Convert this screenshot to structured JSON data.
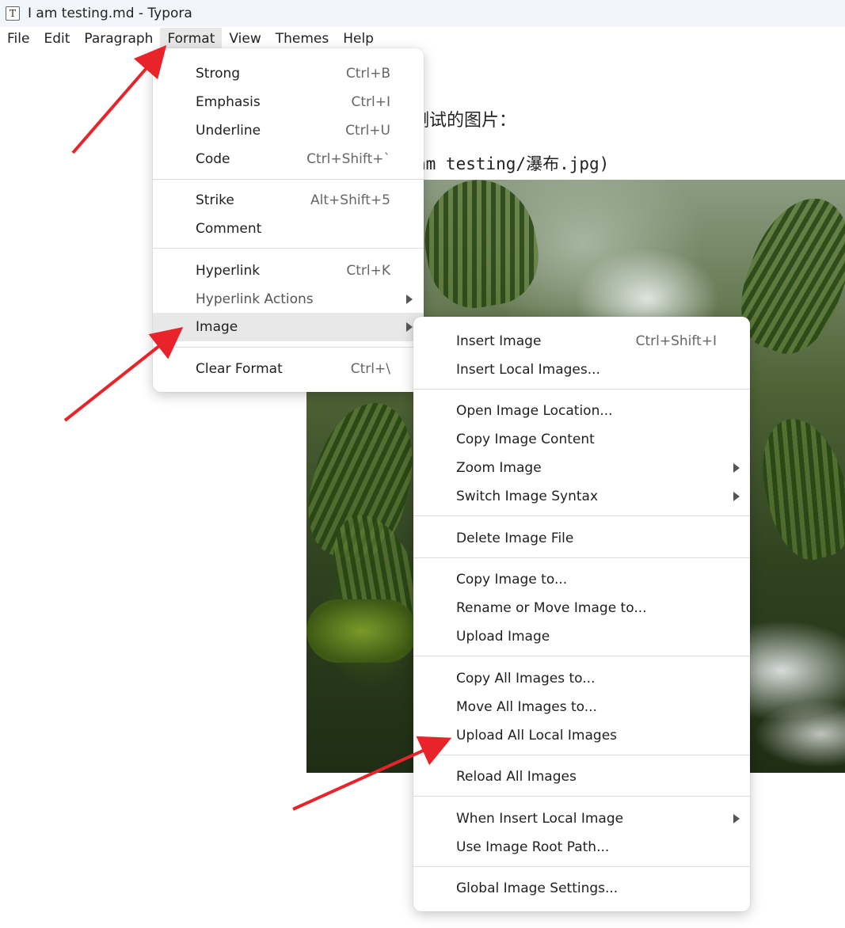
{
  "window": {
    "title": "I am testing.md - Typora",
    "app_icon_letter": "T"
  },
  "menubar": [
    {
      "label": "File"
    },
    {
      "label": "Edit"
    },
    {
      "label": "Paragraph"
    },
    {
      "label": "Format",
      "active": true
    },
    {
      "label": "View"
    },
    {
      "label": "Themes"
    },
    {
      "label": "Help"
    }
  ],
  "document": {
    "line1_visible": "测试的图片：",
    "line2_visible": "am testing/瀑布.jpg)"
  },
  "format_menu": {
    "items": [
      {
        "label": "Strong",
        "shortcut": "Ctrl+B"
      },
      {
        "label": "Emphasis",
        "shortcut": "Ctrl+I"
      },
      {
        "label": "Underline",
        "shortcut": "Ctrl+U"
      },
      {
        "label": "Code",
        "shortcut": "Ctrl+Shift+`"
      },
      {
        "label": "Strike",
        "shortcut": "Alt+Shift+5"
      },
      {
        "label": "Comment",
        "shortcut": ""
      },
      {
        "label": "Hyperlink",
        "shortcut": "Ctrl+K"
      },
      {
        "label": "Hyperlink Actions",
        "shortcut": "",
        "submenu": true,
        "disabled": true
      },
      {
        "label": "Image",
        "shortcut": "",
        "submenu": true,
        "highlighted": true
      },
      {
        "label": "Clear Format",
        "shortcut": "Ctrl+\\"
      }
    ]
  },
  "image_submenu": {
    "items": [
      {
        "label": "Insert Image",
        "shortcut": "Ctrl+Shift+I"
      },
      {
        "label": "Insert Local Images...",
        "shortcut": ""
      },
      {
        "label": "Open Image Location...",
        "shortcut": ""
      },
      {
        "label": "Copy Image Content",
        "shortcut": ""
      },
      {
        "label": "Zoom Image",
        "shortcut": "",
        "submenu": true
      },
      {
        "label": "Switch Image Syntax",
        "shortcut": "",
        "submenu": true
      },
      {
        "label": "Delete Image File",
        "shortcut": ""
      },
      {
        "label": "Copy Image to...",
        "shortcut": ""
      },
      {
        "label": "Rename or Move Image to...",
        "shortcut": ""
      },
      {
        "label": "Upload Image",
        "shortcut": ""
      },
      {
        "label": "Copy All Images to...",
        "shortcut": ""
      },
      {
        "label": "Move All Images to...",
        "shortcut": ""
      },
      {
        "label": "Upload All Local Images",
        "shortcut": ""
      },
      {
        "label": "Reload All Images",
        "shortcut": ""
      },
      {
        "label": "When Insert Local Image",
        "shortcut": "",
        "submenu": true
      },
      {
        "label": "Use Image Root Path...",
        "shortcut": ""
      },
      {
        "label": "Global Image Settings...",
        "shortcut": ""
      }
    ]
  },
  "annotation_color": "#e8242a"
}
